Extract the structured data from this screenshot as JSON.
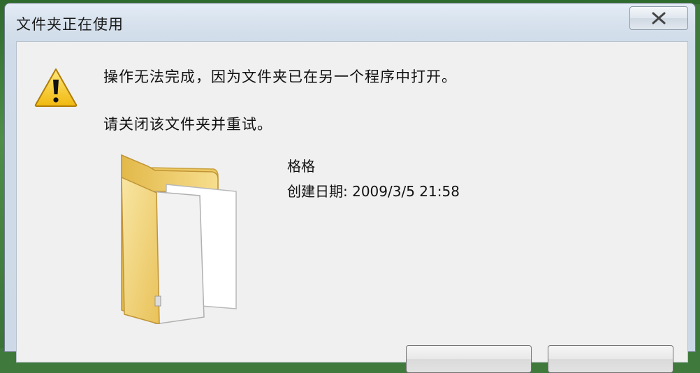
{
  "window": {
    "title": "文件夹正在使用"
  },
  "dialog": {
    "message": "操作无法完成，因为文件夹已在另一个程序中打开。",
    "instruction": "请关闭该文件夹并重试。",
    "folder": {
      "name": "格格",
      "created_label": "创建日期:",
      "created_value": "2009/3/5 21:58"
    }
  },
  "icons": {
    "warning": "warning-icon",
    "folder": "folder-icon",
    "close": "close-icon"
  },
  "colors": {
    "warning_fill": "#f5c518",
    "folder_fill": "#f3d77a",
    "desktop": "#3f7a3c"
  }
}
